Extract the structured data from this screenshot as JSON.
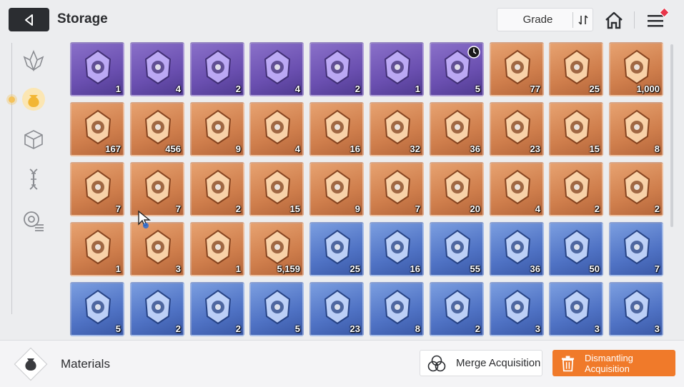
{
  "header": {
    "title": "Storage",
    "grade_label": "Grade"
  },
  "sidebar": {
    "items": [
      {
        "icon": "crystal-leaf-icon",
        "active": false
      },
      {
        "icon": "pouch-icon",
        "active": true
      },
      {
        "icon": "cube-icon",
        "active": false
      },
      {
        "icon": "dna-icon",
        "active": false
      },
      {
        "icon": "target-list-icon",
        "active": false
      }
    ]
  },
  "grid": {
    "items": [
      {
        "grade": "purple",
        "icon": "card-eye-icon",
        "qty": "1"
      },
      {
        "grade": "purple",
        "icon": "book-emblem-icon",
        "qty": "4"
      },
      {
        "grade": "purple",
        "icon": "silver-orb-icon",
        "qty": "2"
      },
      {
        "grade": "purple",
        "icon": "stone-skull-icon",
        "qty": "4"
      },
      {
        "grade": "purple",
        "icon": "stone-face-icon",
        "qty": "2"
      },
      {
        "grade": "purple",
        "icon": "demon-mask-icon",
        "qty": "1"
      },
      {
        "grade": "purple",
        "icon": "triangle-relic-icon",
        "qty": "5",
        "timer": true
      },
      {
        "grade": "orange",
        "icon": "blue-creature-icon",
        "qty": "77"
      },
      {
        "grade": "orange",
        "icon": "cyan-core-icon",
        "qty": "25"
      },
      {
        "grade": "orange",
        "icon": "dark-chip-icon",
        "qty": "1,000"
      },
      {
        "grade": "orange",
        "icon": "gold-ticket-icon",
        "qty": "167"
      },
      {
        "grade": "orange",
        "icon": "rainbow-ticket-icon",
        "qty": "456"
      },
      {
        "grade": "orange",
        "icon": "flesh-eye-icon",
        "qty": "9"
      },
      {
        "grade": "orange",
        "icon": "golden-feather-icon",
        "qty": "4"
      },
      {
        "grade": "orange",
        "icon": "red-crystal-icon",
        "qty": "16"
      },
      {
        "grade": "orange",
        "icon": "orange-crystal-icon",
        "qty": "32"
      },
      {
        "grade": "orange",
        "icon": "purple-crystal-icon",
        "qty": "36"
      },
      {
        "grade": "orange",
        "icon": "sword-book-icon",
        "qty": "23"
      },
      {
        "grade": "orange",
        "icon": "shield-book-icon",
        "qty": "15"
      },
      {
        "grade": "orange",
        "icon": "bolt-book-icon",
        "qty": "8"
      },
      {
        "grade": "orange",
        "icon": "medal-sword-icon",
        "qty": "7"
      },
      {
        "grade": "orange",
        "icon": "medal-shield-icon",
        "qty": "7"
      },
      {
        "grade": "orange",
        "icon": "medal-wing-icon",
        "qty": "2"
      },
      {
        "grade": "orange",
        "icon": "medal-blade-icon",
        "qty": "15"
      },
      {
        "grade": "orange",
        "icon": "medal-bolt-icon",
        "qty": "9"
      },
      {
        "grade": "orange",
        "icon": "medal-target-icon",
        "qty": "7"
      },
      {
        "grade": "orange",
        "icon": "yellow-shards-icon",
        "qty": "20"
      },
      {
        "grade": "orange",
        "icon": "blue-cube-icon",
        "qty": "4"
      },
      {
        "grade": "orange",
        "icon": "star-map-book-icon",
        "qty": "2"
      },
      {
        "grade": "orange",
        "icon": "spray-gun-icon",
        "qty": "2"
      },
      {
        "grade": "orange",
        "icon": "letter-icon",
        "qty": "1"
      },
      {
        "grade": "orange",
        "icon": "dreamcatcher-icon",
        "qty": "3"
      },
      {
        "grade": "orange",
        "icon": "journal-icon",
        "qty": "1"
      },
      {
        "grade": "orange",
        "icon": "music-scroll-icon",
        "qty": "5,159"
      },
      {
        "grade": "blue",
        "icon": "blue-ticket-icon",
        "qty": "25"
      },
      {
        "grade": "blue",
        "icon": "blue-star-ticket-icon",
        "qty": "16"
      },
      {
        "grade": "blue",
        "icon": "red-shard-icon",
        "qty": "55"
      },
      {
        "grade": "blue",
        "icon": "violet-shard-icon",
        "qty": "36"
      },
      {
        "grade": "blue",
        "icon": "ice-shard-icon",
        "qty": "50"
      },
      {
        "grade": "blue",
        "icon": "blue-sword-book-icon",
        "qty": "7"
      },
      {
        "grade": "blue",
        "icon": "blue-book-a-icon",
        "qty": "5"
      },
      {
        "grade": "blue",
        "icon": "blue-book-b-icon",
        "qty": "2"
      },
      {
        "grade": "blue",
        "icon": "blue-book-c-icon",
        "qty": "2"
      },
      {
        "grade": "blue",
        "icon": "blue-book-d-icon",
        "qty": "5"
      },
      {
        "grade": "blue",
        "icon": "silver-medal-a-icon",
        "qty": "23"
      },
      {
        "grade": "blue",
        "icon": "silver-medal-b-icon",
        "qty": "8"
      },
      {
        "grade": "blue",
        "icon": "silver-medal-c-icon",
        "qty": "2"
      },
      {
        "grade": "blue",
        "icon": "ice-gem-icon",
        "qty": "3"
      },
      {
        "grade": "blue",
        "icon": "cake-icon",
        "qty": "3"
      },
      {
        "grade": "blue",
        "icon": "pocket-watch-icon",
        "qty": "3"
      }
    ]
  },
  "footer": {
    "category_label": "Materials",
    "merge_label": "Merge Acquisition",
    "dismantle_label": "Dismantling Acquisition"
  },
  "colors": {
    "purple": "#6a4fb0",
    "orange": "#cf7e4c",
    "blue": "#4f72c4",
    "accent": "#f07a2a"
  }
}
